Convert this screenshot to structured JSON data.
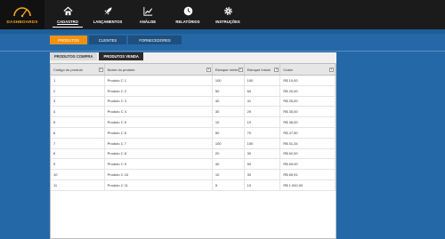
{
  "brand": {
    "label": "DASHBOARDS",
    "icon": "gauge-icon"
  },
  "nav": [
    {
      "label": "CADASTRO",
      "icon": "home-icon",
      "active": true
    },
    {
      "label": "LANÇAMENTOS",
      "icon": "rocket-icon"
    },
    {
      "label": "ANÁLISE",
      "icon": "chart-icon"
    },
    {
      "label": "RELATÓRIOS",
      "icon": "clock-icon"
    },
    {
      "label": "INSTRUÇÕES",
      "icon": "gear-icon"
    }
  ],
  "category_tabs": [
    {
      "label": "PRODUTOS",
      "active": true
    },
    {
      "label": "CLIENTES"
    },
    {
      "label": "FORNECEDORES"
    }
  ],
  "sub_tabs": [
    {
      "label": "PRODUTOS COMPRA"
    },
    {
      "label": "PRODUTOS VENDA",
      "active": true
    }
  ],
  "table": {
    "columns": [
      "Código do produto",
      "Nome do produto",
      "Estoque mínimo",
      "Estoque Inicial",
      "Custo"
    ],
    "rows": [
      [
        "1",
        "Produto C 1",
        "100",
        "100",
        "R$ 10,00"
      ],
      [
        "2",
        "Produto C 2",
        "50",
        "60",
        "R$ 20,00"
      ],
      [
        "3",
        "Produto C 3",
        "40",
        "41",
        "R$ 25,00"
      ],
      [
        "4",
        "Produto C 4",
        "30",
        "29",
        "R$ 30,00"
      ],
      [
        "5",
        "Produto C 5",
        "10",
        "10",
        "R$ 36,00"
      ],
      [
        "6",
        "Produto C 6",
        "50",
        "70",
        "R$ 47,50"
      ],
      [
        "7",
        "Produto C 7",
        "100",
        "150",
        "R$ 51,34"
      ],
      [
        "8",
        "Produto C 8",
        "20",
        "30",
        "R$ 62,00"
      ],
      [
        "9",
        "Produto C 9",
        "40",
        "50",
        "R$ 69,00"
      ],
      [
        "10",
        "Produto C 10",
        "10",
        "30",
        "R$ 69,91"
      ],
      [
        "11",
        "Produto C 11",
        "5",
        "10",
        "R$ 1.000,00"
      ]
    ]
  }
}
